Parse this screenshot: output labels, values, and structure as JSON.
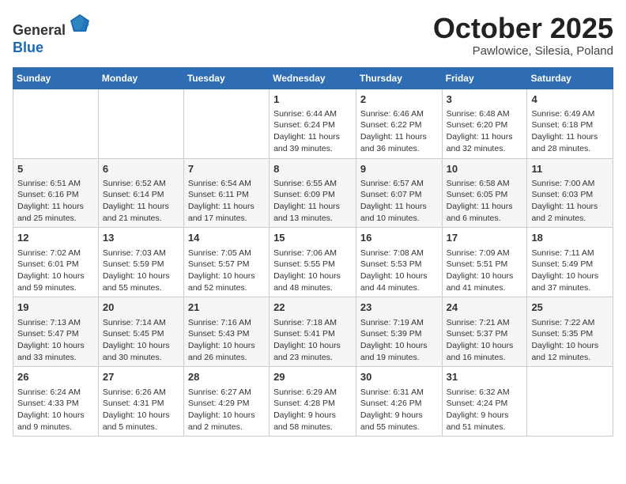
{
  "header": {
    "logo_line1": "General",
    "logo_line2": "Blue",
    "month_year": "October 2025",
    "location": "Pawlowice, Silesia, Poland"
  },
  "weekdays": [
    "Sunday",
    "Monday",
    "Tuesday",
    "Wednesday",
    "Thursday",
    "Friday",
    "Saturday"
  ],
  "weeks": [
    [
      {
        "day": "",
        "content": ""
      },
      {
        "day": "",
        "content": ""
      },
      {
        "day": "",
        "content": ""
      },
      {
        "day": "1",
        "content": "Sunrise: 6:44 AM\nSunset: 6:24 PM\nDaylight: 11 hours and 39 minutes."
      },
      {
        "day": "2",
        "content": "Sunrise: 6:46 AM\nSunset: 6:22 PM\nDaylight: 11 hours and 36 minutes."
      },
      {
        "day": "3",
        "content": "Sunrise: 6:48 AM\nSunset: 6:20 PM\nDaylight: 11 hours and 32 minutes."
      },
      {
        "day": "4",
        "content": "Sunrise: 6:49 AM\nSunset: 6:18 PM\nDaylight: 11 hours and 28 minutes."
      }
    ],
    [
      {
        "day": "5",
        "content": "Sunrise: 6:51 AM\nSunset: 6:16 PM\nDaylight: 11 hours and 25 minutes."
      },
      {
        "day": "6",
        "content": "Sunrise: 6:52 AM\nSunset: 6:14 PM\nDaylight: 11 hours and 21 minutes."
      },
      {
        "day": "7",
        "content": "Sunrise: 6:54 AM\nSunset: 6:11 PM\nDaylight: 11 hours and 17 minutes."
      },
      {
        "day": "8",
        "content": "Sunrise: 6:55 AM\nSunset: 6:09 PM\nDaylight: 11 hours and 13 minutes."
      },
      {
        "day": "9",
        "content": "Sunrise: 6:57 AM\nSunset: 6:07 PM\nDaylight: 11 hours and 10 minutes."
      },
      {
        "day": "10",
        "content": "Sunrise: 6:58 AM\nSunset: 6:05 PM\nDaylight: 11 hours and 6 minutes."
      },
      {
        "day": "11",
        "content": "Sunrise: 7:00 AM\nSunset: 6:03 PM\nDaylight: 11 hours and 2 minutes."
      }
    ],
    [
      {
        "day": "12",
        "content": "Sunrise: 7:02 AM\nSunset: 6:01 PM\nDaylight: 10 hours and 59 minutes."
      },
      {
        "day": "13",
        "content": "Sunrise: 7:03 AM\nSunset: 5:59 PM\nDaylight: 10 hours and 55 minutes."
      },
      {
        "day": "14",
        "content": "Sunrise: 7:05 AM\nSunset: 5:57 PM\nDaylight: 10 hours and 52 minutes."
      },
      {
        "day": "15",
        "content": "Sunrise: 7:06 AM\nSunset: 5:55 PM\nDaylight: 10 hours and 48 minutes."
      },
      {
        "day": "16",
        "content": "Sunrise: 7:08 AM\nSunset: 5:53 PM\nDaylight: 10 hours and 44 minutes."
      },
      {
        "day": "17",
        "content": "Sunrise: 7:09 AM\nSunset: 5:51 PM\nDaylight: 10 hours and 41 minutes."
      },
      {
        "day": "18",
        "content": "Sunrise: 7:11 AM\nSunset: 5:49 PM\nDaylight: 10 hours and 37 minutes."
      }
    ],
    [
      {
        "day": "19",
        "content": "Sunrise: 7:13 AM\nSunset: 5:47 PM\nDaylight: 10 hours and 33 minutes."
      },
      {
        "day": "20",
        "content": "Sunrise: 7:14 AM\nSunset: 5:45 PM\nDaylight: 10 hours and 30 minutes."
      },
      {
        "day": "21",
        "content": "Sunrise: 7:16 AM\nSunset: 5:43 PM\nDaylight: 10 hours and 26 minutes."
      },
      {
        "day": "22",
        "content": "Sunrise: 7:18 AM\nSunset: 5:41 PM\nDaylight: 10 hours and 23 minutes."
      },
      {
        "day": "23",
        "content": "Sunrise: 7:19 AM\nSunset: 5:39 PM\nDaylight: 10 hours and 19 minutes."
      },
      {
        "day": "24",
        "content": "Sunrise: 7:21 AM\nSunset: 5:37 PM\nDaylight: 10 hours and 16 minutes."
      },
      {
        "day": "25",
        "content": "Sunrise: 7:22 AM\nSunset: 5:35 PM\nDaylight: 10 hours and 12 minutes."
      }
    ],
    [
      {
        "day": "26",
        "content": "Sunrise: 6:24 AM\nSunset: 4:33 PM\nDaylight: 10 hours and 9 minutes."
      },
      {
        "day": "27",
        "content": "Sunrise: 6:26 AM\nSunset: 4:31 PM\nDaylight: 10 hours and 5 minutes."
      },
      {
        "day": "28",
        "content": "Sunrise: 6:27 AM\nSunset: 4:29 PM\nDaylight: 10 hours and 2 minutes."
      },
      {
        "day": "29",
        "content": "Sunrise: 6:29 AM\nSunset: 4:28 PM\nDaylight: 9 hours and 58 minutes."
      },
      {
        "day": "30",
        "content": "Sunrise: 6:31 AM\nSunset: 4:26 PM\nDaylight: 9 hours and 55 minutes."
      },
      {
        "day": "31",
        "content": "Sunrise: 6:32 AM\nSunset: 4:24 PM\nDaylight: 9 hours and 51 minutes."
      },
      {
        "day": "",
        "content": ""
      }
    ]
  ]
}
